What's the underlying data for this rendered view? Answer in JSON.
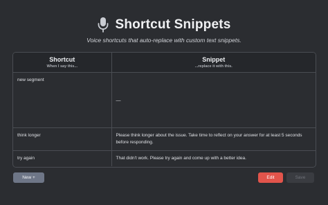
{
  "header": {
    "title": "Shortcut Snippets",
    "subtitle": "Voice shortcuts that auto-replace with custom text snippets.",
    "icon": "microphone-icon"
  },
  "table": {
    "columns": [
      {
        "title": "Shortcut",
        "hint": "When I say this..."
      },
      {
        "title": "Snippet",
        "hint": "...replace it with this."
      }
    ],
    "rows": [
      {
        "shortcut": "new segment",
        "snippet": "—"
      },
      {
        "shortcut": "think longer",
        "snippet": "Please think longer about the issue. Take time to reflect on your answer for at least 5 seconds before responding."
      },
      {
        "shortcut": "try again",
        "snippet": "That didn't work. Please try again and come up with a better idea."
      }
    ]
  },
  "actions": {
    "new_label": "New +",
    "edit_label": "Edit",
    "save_label": "Save"
  },
  "colors": {
    "background": "#2b2d31",
    "edit_button": "#e2544b",
    "new_button": "#6e7687"
  }
}
